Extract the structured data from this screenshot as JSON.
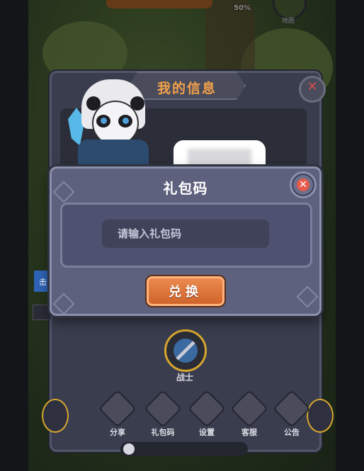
{
  "hud": {
    "percent": "50%",
    "map_label": "地图"
  },
  "profile": {
    "title": "我的信息",
    "class_label": "战士",
    "side_tab_text": "击",
    "menu": [
      {
        "label": "分享",
        "icon": "share-icon",
        "glyph": "⊲"
      },
      {
        "label": "礼包码",
        "icon": "gift-icon",
        "glyph": "▣"
      },
      {
        "label": "设置",
        "icon": "gear-icon",
        "glyph": "⚙"
      },
      {
        "label": "客服",
        "icon": "headset-icon",
        "glyph": "☊"
      },
      {
        "label": "公告",
        "icon": "announcement-icon",
        "glyph": "▤"
      }
    ]
  },
  "gift_dialog": {
    "title": "礼包码",
    "input_placeholder": "请输入礼包码",
    "input_value": "",
    "redeem_label": "兑换",
    "close_glyph": "✕"
  },
  "colors": {
    "accent_orange": "#d0642b",
    "title_orange": "#f3a04a",
    "close_red": "#e55a4c",
    "dialog_bg": "#5d617d"
  }
}
